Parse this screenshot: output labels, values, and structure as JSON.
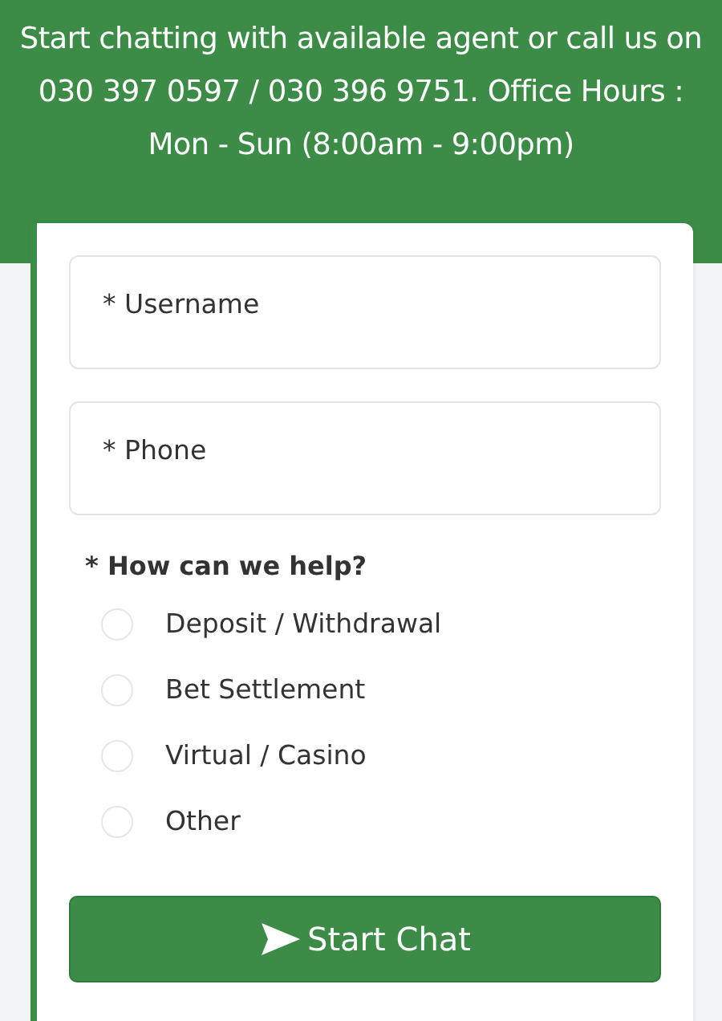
{
  "header": {
    "text": "Start chatting with available agent or call us on 030 397 0597 / 030 396 9751. Office Hours : Mon - Sun (8:00am - 9:00pm)"
  },
  "fields": [
    {
      "placeholder": "* Username"
    },
    {
      "placeholder": "* Phone"
    }
  ],
  "question": "* How can we help?",
  "options": [
    {
      "label": "Deposit / Withdrawal",
      "selected": false
    },
    {
      "label": "Bet Settlement",
      "selected": false
    },
    {
      "label": "Virtual / Casino",
      "selected": false
    },
    {
      "label": "Other",
      "selected": false
    }
  ],
  "button": {
    "label": "Start Chat"
  }
}
